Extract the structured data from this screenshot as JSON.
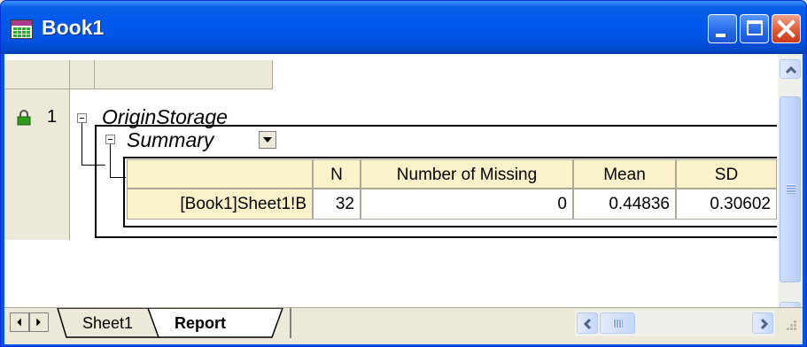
{
  "window": {
    "title": "Book1",
    "controls": [
      "minimize-icon",
      "maximize-icon",
      "close-icon"
    ]
  },
  "tree": {
    "row_number": "1",
    "root": "OriginStorage",
    "child": "Summary"
  },
  "table": {
    "headers": [
      "",
      "N",
      "Number of Missing",
      "Mean",
      "SD"
    ],
    "rows": [
      [
        "[Book1]Sheet1!B",
        "32",
        "0",
        "0.44836",
        "0.30602"
      ]
    ]
  },
  "sheet_tabs": {
    "tabs": [
      "Sheet1",
      "Report"
    ],
    "active": "Report"
  },
  "colors": {
    "title_bar": "#0055e5",
    "header_cell": "#fcf2c9",
    "chrome": "#ece9d8"
  }
}
